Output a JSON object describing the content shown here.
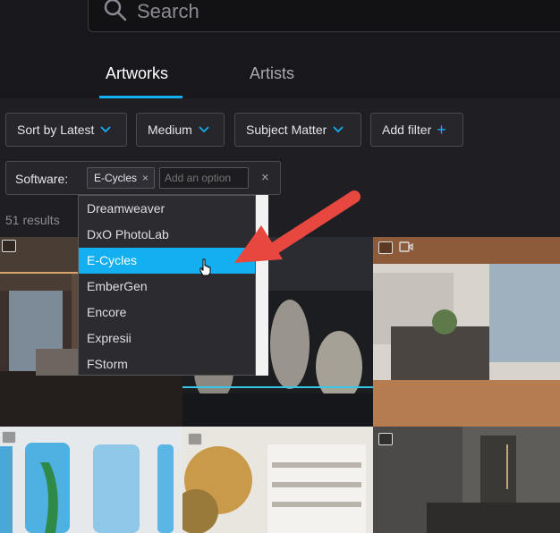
{
  "search": {
    "placeholder": "Search"
  },
  "tabs": [
    {
      "label": "Artworks",
      "active": true
    },
    {
      "label": "Artists",
      "active": false
    }
  ],
  "filters": {
    "sort_label": "Sort by Latest",
    "medium_label": "Medium",
    "subject_label": "Subject Matter",
    "add_filter_label": "Add filter",
    "add_filter_icon": "+"
  },
  "software_filter": {
    "label": "Software:",
    "chip_label": "E-Cycles",
    "chip_remove": "×",
    "option_placeholder": "Add an option",
    "clear": "×"
  },
  "results": {
    "count_text": "51 results"
  },
  "dropdown": {
    "items": [
      "Dreamweaver",
      "DxO PhotoLab",
      "E-Cycles",
      "EmberGen",
      "Encore",
      "Expresii",
      "FStorm"
    ],
    "selected": "E-Cycles"
  },
  "colors": {
    "accent": "#13aff0",
    "annotation_arrow": "#e8473f",
    "background": "#1f1f23"
  },
  "icons": [
    "search-icon",
    "chevron-down-icon",
    "plus-icon",
    "close-icon",
    "image-icon",
    "video-icon",
    "cursor-hand-icon",
    "arrow-annotation"
  ]
}
